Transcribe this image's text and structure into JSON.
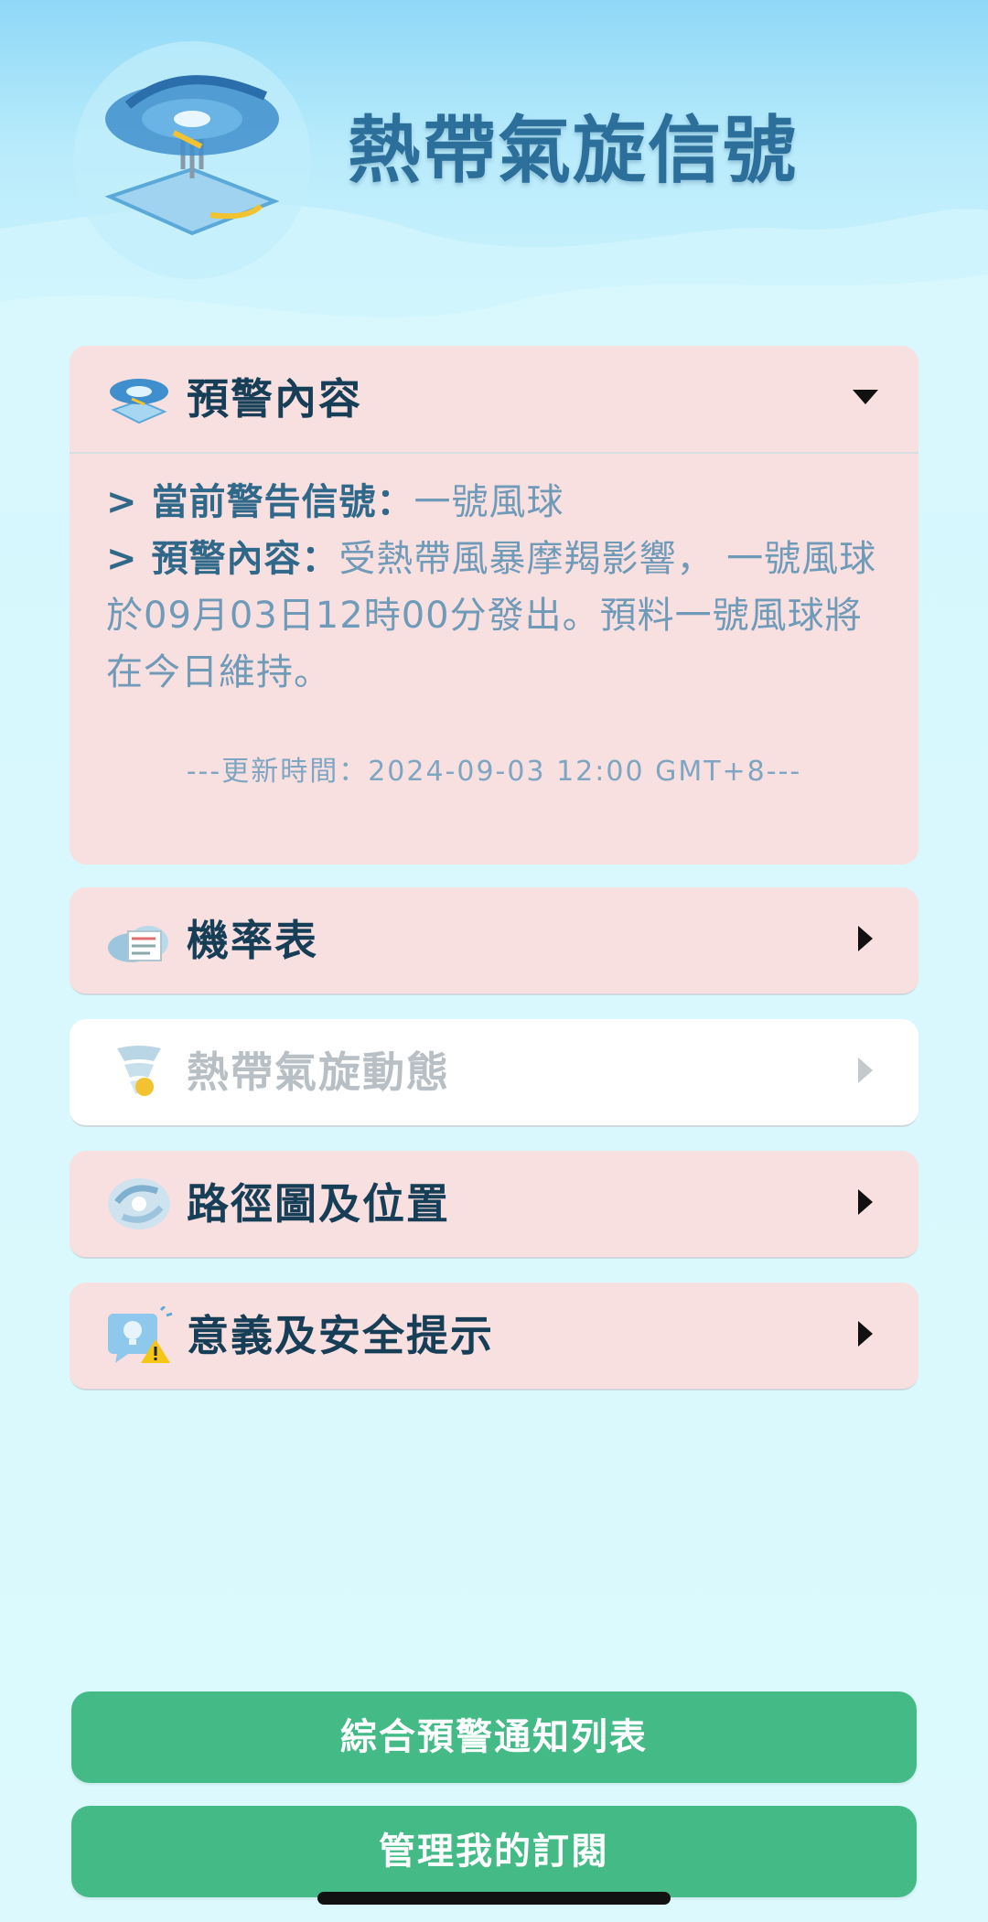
{
  "header": {
    "title": "熱帶氣旋信號"
  },
  "warning_card": {
    "title": "預警內容",
    "current_signal_label": "當前警告信號：",
    "current_signal_value": "一號風球",
    "content_label": "預警內容：",
    "content_value": "受熱帶風暴摩羯影響， 一號風球於09月03日12時00分發出。預料一號風球將在今日維持。",
    "update_time": "---更新時間：2024-09-03 12:00 GMT+8---"
  },
  "menu": [
    {
      "title": "機率表"
    },
    {
      "title": "熱帶氣旋動態"
    },
    {
      "title": "路徑圖及位置"
    },
    {
      "title": "意義及安全提示"
    }
  ],
  "buttons": {
    "alerts_list": "綜合預警通知列表",
    "manage_subscription": "管理我的訂閱"
  },
  "colors": {
    "card_bg": "#f9e0e0",
    "button_green": "#44bb87",
    "title_blue": "#2c6f9b"
  }
}
